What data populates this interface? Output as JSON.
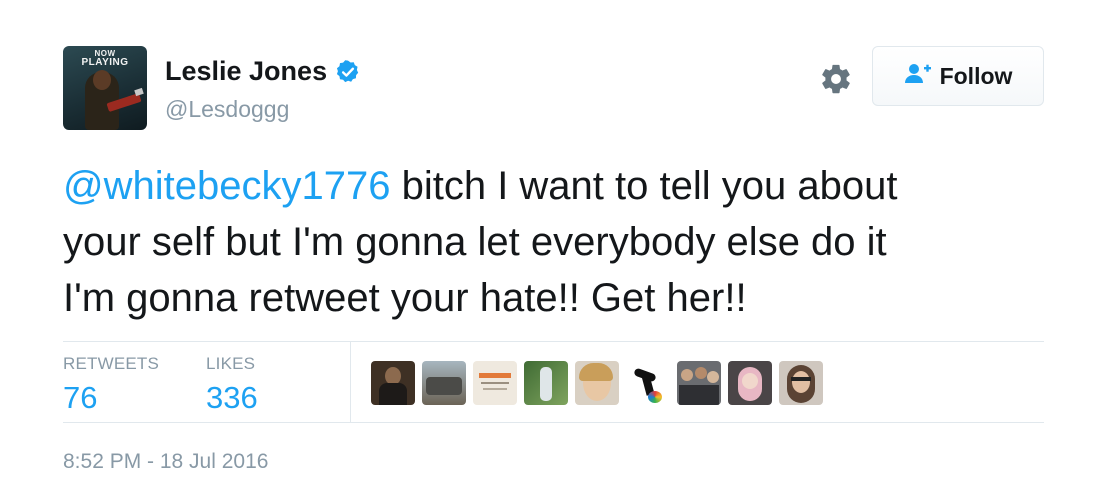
{
  "user": {
    "avatar_text_top": "NOW",
    "avatar_text_bottom": "PLAYING",
    "name": "Leslie Jones",
    "handle": "@Lesdoggg",
    "verified_icon": "verified-badge-icon",
    "verified_color": "#1da1f2"
  },
  "actions": {
    "settings_icon": "gear-icon",
    "follow_label": "Follow",
    "follow_icon": "add-user-icon"
  },
  "tweet": {
    "mention": "@whitebecky1776",
    "text_line1": " bitch I want to tell you about",
    "text_line2": "your self but I'm gonna let everybody else do it",
    "text_line3": "I'm gonna retweet your hate!! Get her!!"
  },
  "stats": {
    "retweets_label": "RETWEETS",
    "retweets_value": "76",
    "likes_label": "LIKES",
    "likes_value": "336"
  },
  "likers": [
    {
      "name": "liker-avatar-1",
      "bg": "#4a3a2c"
    },
    {
      "name": "liker-avatar-2",
      "bg": "#7d8a8f"
    },
    {
      "name": "liker-avatar-3",
      "bg": "#ece7de"
    },
    {
      "name": "liker-avatar-4",
      "bg": "#3c5a32"
    },
    {
      "name": "liker-avatar-5",
      "bg": "#d8cfc2"
    },
    {
      "name": "liker-avatar-6",
      "bg": "#ffffff"
    },
    {
      "name": "liker-avatar-7",
      "bg": "#5d5e62"
    },
    {
      "name": "liker-avatar-8",
      "bg": "#c8b4b8"
    },
    {
      "name": "liker-avatar-9",
      "bg": "#b9b0a8"
    }
  ],
  "timestamp": "8:52 PM - 18 Jul 2016",
  "colors": {
    "accent": "#1da1f2",
    "muted": "#8899a6",
    "text": "#14171a"
  }
}
